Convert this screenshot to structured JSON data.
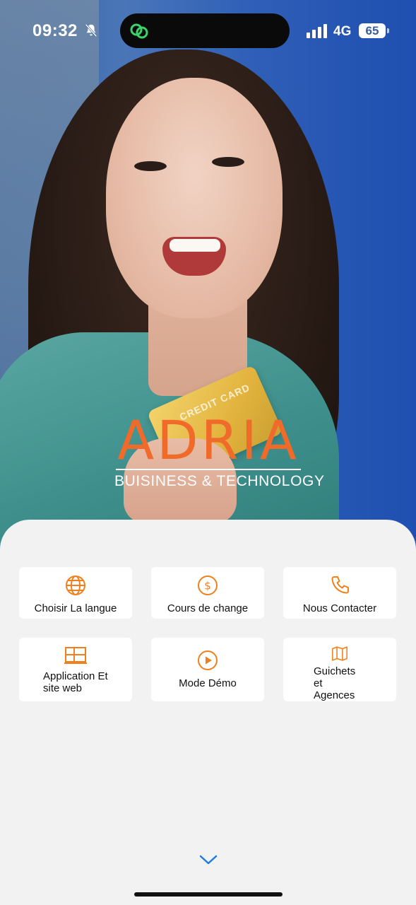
{
  "status_bar": {
    "time": "09:32",
    "network": "4G",
    "battery": "65"
  },
  "logo": {
    "brand": "ADRIA",
    "tagline": "BUISINESS & TECHNOLOGY"
  },
  "hero": {
    "card_text": "CREDIT CARD"
  },
  "menu": {
    "language": "Choisir La langue",
    "exchange": "Cours de change",
    "contact": "Nous Contacter",
    "app_line1": "Application Et",
    "app_line2": "site web",
    "demo": "Mode Démo",
    "agencies_line1": "Guichets",
    "agencies_line2": "et Agences"
  },
  "colors": {
    "accent": "#f0801c",
    "brand": "#f06a2a",
    "chevron": "#1e7be0"
  },
  "icons": {
    "language": "globe-icon",
    "exchange": "dollar-circle-icon",
    "contact": "phone-icon",
    "app": "window-icon",
    "demo": "play-circle-icon",
    "agencies": "map-icon",
    "more": "chevron-down-icon"
  }
}
